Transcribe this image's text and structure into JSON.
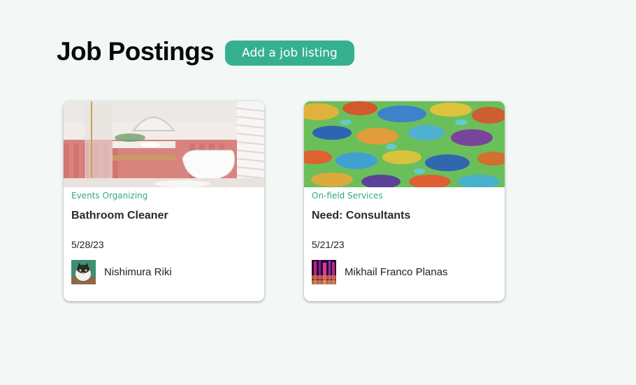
{
  "header": {
    "title": "Job Postings",
    "add_button_label": "Add a job listing"
  },
  "colors": {
    "accent": "#37b092",
    "category_text": "#2fa88a",
    "background": "#f3f8f6"
  },
  "cards": [
    {
      "image_icon": "bathroom-photo",
      "category": "Events Organizing",
      "title": "Bathroom Cleaner",
      "date": "5/28/23",
      "author": {
        "avatar_icon": "cat-avatar",
        "name": "Nishimura Riki"
      }
    },
    {
      "image_icon": "abstract-pattern-photo",
      "category": "On-field Services",
      "title": "Need: Consultants",
      "date": "5/21/23",
      "author": {
        "avatar_icon": "abstract-avatar",
        "name": "Mikhail Franco Planas"
      }
    }
  ]
}
